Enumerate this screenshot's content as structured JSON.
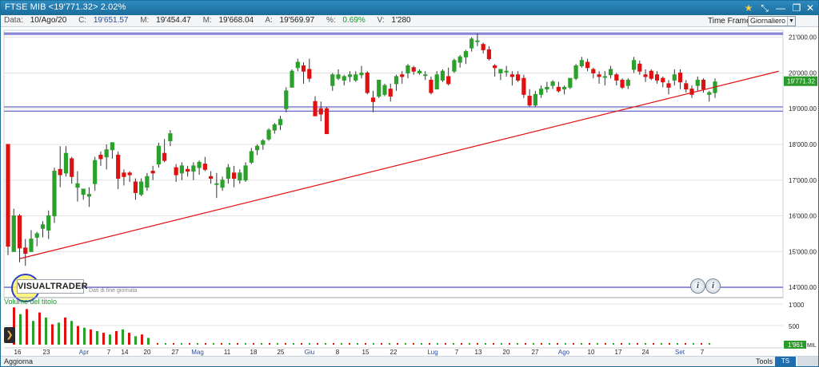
{
  "window": {
    "title": "FTSE MIB <19'771.32> 2.02%",
    "controls": [
      "star-icon",
      "resize-icon",
      "pin-icon",
      "restore-icon",
      "close-icon"
    ]
  },
  "toolbar": {
    "data_label": "Data:",
    "data_value": "10/Ago/20",
    "c_label": "C:",
    "c_value": "19'651.57",
    "m_label": "M:",
    "m_value": "19'454.47",
    "mx_label": "M:",
    "mx_value": "19'668.04",
    "a_label": "A:",
    "a_value": "19'569.97",
    "pct_label": "%:",
    "pct_value": "0.69%",
    "v_label": "V:",
    "v_value": "1'280",
    "timeframe_label": "Time Frame",
    "timeframe_value": "Giornaliero"
  },
  "chart": {
    "watermark": "VISUALTRADER",
    "note": "Dati di fine giornata",
    "price_badge": "19'771.32",
    "volume_title": "Volume del titolo",
    "volume_badge": "1'961",
    "volume_unit": "MIL",
    "colors": {
      "up": "#2aa12a",
      "down": "#e01010",
      "trendline": "#e01010",
      "grid": "#e2e2e2",
      "hline": "#3f3fc0",
      "badge": "#2a9a2a"
    }
  },
  "chart_data": {
    "type": "candlestick",
    "y_ticks": [
      "21'000.00",
      "20'000.00",
      "19'000.00",
      "18'000.00",
      "17'000.00",
      "16'000.00",
      "15'000.00",
      "14'000.00"
    ],
    "ylim": [
      13800,
      21150
    ],
    "x_ticks": [
      "16",
      "23",
      "Apr",
      "7",
      "14",
      "20",
      "27",
      "Mag",
      "11",
      "18",
      "25",
      "Giu",
      "8",
      "15",
      "22",
      "Lug",
      "7",
      "13",
      "20",
      "27",
      "Ago",
      "10",
      "17",
      "24",
      "Set",
      "7"
    ],
    "volume_ticks": [
      "1'000",
      "500"
    ],
    "horizontal_lines": [
      21120,
      14000
    ],
    "candles": [
      [
        18000,
        18000,
        14900,
        15150
      ],
      [
        15000,
        16200,
        15000,
        16000
      ],
      [
        16000,
        16050,
        14700,
        15100
      ],
      [
        15100,
        15350,
        14600,
        14950
      ],
      [
        15000,
        15600,
        15000,
        15350
      ],
      [
        15400,
        15550,
        15150,
        15500
      ],
      [
        15650,
        15850,
        15400,
        15750
      ],
      [
        15600,
        16150,
        15350,
        16000
      ],
      [
        16000,
        17350,
        15800,
        17250
      ],
      [
        17300,
        17950,
        16800,
        17150
      ],
      [
        17200,
        17950,
        17100,
        17750
      ],
      [
        17600,
        17650,
        16900,
        17100
      ],
      [
        16800,
        17250,
        16400,
        16900
      ],
      [
        16600,
        16750,
        16450,
        16750
      ],
      [
        16550,
        16800,
        16250,
        16600
      ],
      [
        16900,
        17650,
        16700,
        17550
      ],
      [
        17700,
        17800,
        17400,
        17600
      ],
      [
        17650,
        18000,
        17300,
        17850
      ],
      [
        17850,
        18000,
        17600,
        18050
      ],
      [
        17700,
        17800,
        16750,
        17050
      ],
      [
        17200,
        17300,
        16850,
        17100
      ],
      [
        17200,
        17250,
        16950,
        17150
      ],
      [
        16950,
        17050,
        16450,
        16650
      ],
      [
        16600,
        17050,
        16550,
        16950
      ],
      [
        16800,
        17200,
        16700,
        17100
      ],
      [
        17250,
        17400,
        17000,
        17200
      ],
      [
        17450,
        18050,
        17350,
        17950
      ],
      [
        17750,
        18150,
        17500,
        17550
      ],
      [
        18100,
        18400,
        17950,
        18300
      ],
      [
        17350,
        17450,
        16950,
        17150
      ],
      [
        17200,
        17500,
        17000,
        17400
      ],
      [
        17300,
        17400,
        17100,
        17250
      ],
      [
        17250,
        17500,
        17000,
        17400
      ],
      [
        17350,
        17550,
        17150,
        17500
      ],
      [
        17450,
        17650,
        17250,
        17300
      ],
      [
        17100,
        17250,
        16900,
        17050
      ],
      [
        16900,
        17200,
        16500,
        16900
      ],
      [
        16800,
        17100,
        16700,
        17000
      ],
      [
        17050,
        17450,
        16900,
        17350
      ],
      [
        17200,
        17400,
        16800,
        17050
      ],
      [
        17000,
        17300,
        16900,
        17200
      ],
      [
        17000,
        17500,
        16950,
        17400
      ],
      [
        17500,
        17900,
        17450,
        17800
      ],
      [
        17850,
        18000,
        17700,
        17950
      ],
      [
        18000,
        18150,
        17850,
        18100
      ],
      [
        18150,
        18450,
        18100,
        18400
      ],
      [
        18400,
        18600,
        18300,
        18550
      ],
      [
        18550,
        18800,
        18400,
        18700
      ],
      [
        19000,
        19600,
        18900,
        19500
      ],
      [
        19600,
        20100,
        19600,
        20050
      ],
      [
        20150,
        20400,
        20050,
        20300
      ],
      [
        20200,
        20300,
        19700,
        20050
      ],
      [
        20100,
        20400,
        19750,
        19850
      ],
      [
        19200,
        19350,
        18800,
        18800
      ],
      [
        19000,
        19200,
        18650,
        18850
      ],
      [
        19000,
        19050,
        18300,
        18300
      ],
      [
        19650,
        20000,
        19500,
        19950
      ],
      [
        19850,
        20100,
        19800,
        19950
      ],
      [
        19800,
        19950,
        19650,
        19900
      ],
      [
        19900,
        20050,
        19750,
        19950
      ],
      [
        19800,
        20050,
        19750,
        19950
      ],
      [
        19950,
        20200,
        19850,
        20000
      ],
      [
        20000,
        20050,
        19400,
        19450
      ],
      [
        19300,
        19500,
        18900,
        19200
      ],
      [
        19350,
        19800,
        19300,
        19800
      ],
      [
        19400,
        19700,
        19350,
        19650
      ],
      [
        19550,
        19700,
        19200,
        19350
      ],
      [
        19700,
        19950,
        19500,
        19900
      ],
      [
        19950,
        20050,
        19700,
        19900
      ],
      [
        20000,
        20250,
        19850,
        20200
      ],
      [
        20150,
        20200,
        19950,
        20050
      ],
      [
        20000,
        20100,
        19950,
        20050
      ],
      [
        19950,
        20050,
        19800,
        19950
      ],
      [
        19800,
        19900,
        19400,
        19450
      ],
      [
        19550,
        20050,
        19550,
        19950
      ],
      [
        19800,
        20100,
        19750,
        20050
      ],
      [
        19900,
        20150,
        19650,
        19700
      ],
      [
        20050,
        20400,
        20000,
        20350
      ],
      [
        20300,
        20500,
        20150,
        20450
      ],
      [
        20450,
        20650,
        20250,
        20600
      ],
      [
        20700,
        21000,
        20600,
        20950
      ],
      [
        20900,
        21100,
        20750,
        20900
      ],
      [
        20800,
        20850,
        20550,
        20650
      ],
      [
        20650,
        20750,
        20350,
        20400
      ],
      [
        20200,
        20250,
        19900,
        20150
      ],
      [
        20000,
        20100,
        19800,
        20100
      ],
      [
        20050,
        20200,
        19900,
        20050
      ],
      [
        19950,
        20050,
        19650,
        19900
      ],
      [
        19950,
        20050,
        19750,
        19800
      ],
      [
        19850,
        19950,
        19300,
        19400
      ],
      [
        19350,
        19550,
        19050,
        19100
      ],
      [
        19100,
        19500,
        19050,
        19400
      ],
      [
        19400,
        19650,
        19300,
        19550
      ],
      [
        19550,
        19750,
        19450,
        19600
      ],
      [
        19650,
        19800,
        19550,
        19750
      ],
      [
        19600,
        19750,
        19450,
        19500
      ],
      [
        19550,
        19650,
        19400,
        19600
      ],
      [
        19600,
        19850,
        19550,
        19850
      ],
      [
        19850,
        20250,
        19800,
        20200
      ],
      [
        20200,
        20450,
        20150,
        20350
      ],
      [
        20300,
        20400,
        20050,
        20150
      ],
      [
        20100,
        20150,
        19850,
        20000
      ],
      [
        19950,
        20050,
        19700,
        19900
      ],
      [
        19900,
        20050,
        19650,
        19900
      ],
      [
        19950,
        20200,
        19850,
        20100
      ],
      [
        19950,
        20000,
        19650,
        19800
      ],
      [
        19800,
        19850,
        19550,
        19600
      ],
      [
        19650,
        19850,
        19550,
        19800
      ],
      [
        20100,
        20450,
        20000,
        20350
      ],
      [
        20250,
        20350,
        19950,
        20050
      ],
      [
        19950,
        20100,
        19750,
        19900
      ],
      [
        20050,
        20100,
        19800,
        19850
      ],
      [
        19950,
        20050,
        19700,
        19800
      ],
      [
        19850,
        19900,
        19600,
        19750
      ],
      [
        19700,
        19800,
        19400,
        19600
      ],
      [
        19800,
        20100,
        19650,
        19950
      ],
      [
        20000,
        20100,
        19550,
        19750
      ],
      [
        19700,
        19800,
        19450,
        19550
      ],
      [
        19550,
        19650,
        19300,
        19400
      ],
      [
        19650,
        19900,
        19500,
        19800
      ],
      [
        19800,
        19850,
        19450,
        19550
      ],
      [
        19400,
        19500,
        19200,
        19450
      ],
      [
        19450,
        19850,
        19300,
        19750
      ]
    ],
    "trendline": {
      "from_index": 2,
      "from_value": 14800,
      "to_index": 133,
      "to_value": 20050
    },
    "volume": {
      "ymax": 1200,
      "values": [
        1100,
        900,
        1050,
        700,
        950,
        800,
        600,
        650,
        800,
        700,
        550,
        500,
        450,
        400,
        350,
        300,
        400,
        450,
        350,
        250,
        300,
        200
      ],
      "colors": [
        "down",
        "up",
        "down",
        "up",
        "down",
        "up",
        "down",
        "up",
        "down",
        "up",
        "down",
        "up",
        "down",
        "up",
        "down",
        "up",
        "down",
        "up",
        "down",
        "up",
        "down",
        "up"
      ]
    }
  }
}
